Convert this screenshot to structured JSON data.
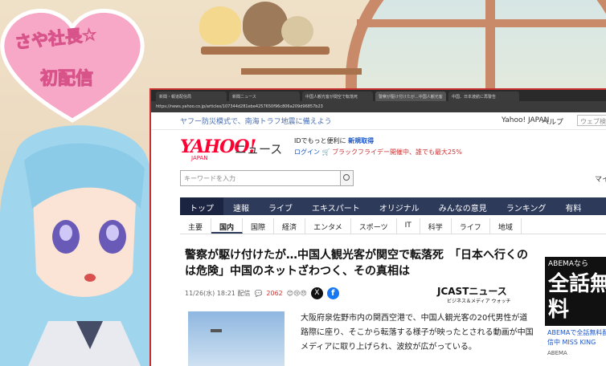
{
  "overlay": {
    "heart_line1": "さや社長☆",
    "heart_line2": "初配信"
  },
  "browser": {
    "tabs": [
      {
        "label": "新聞・報道配信局"
      },
      {
        "label": "新聞ニュース"
      },
      {
        "label": "中国人観光客が関空で転落死"
      },
      {
        "label": "警察が駆け付けたが...中国人観光客"
      },
      {
        "label": "中国、日本渡航に再警告"
      }
    ],
    "url": "https://news.yahoo.co.jp/articles/107344d281ebe4257650f96c806a209d96857b23"
  },
  "yahoo": {
    "disaster_link": "ヤフー防災模式で、南海トラフ地震に備えよう",
    "yahoo_japan_link": "Yahoo! JAPAN",
    "help_link": "ヘルプ",
    "web_search_placeholder": "ウェブ検索",
    "logo_text": "YAHOO!",
    "logo_sub": "JAPAN",
    "logo_news": "ニュース",
    "id_line_text": "IDでもっと便利に",
    "id_line_link": "新規取得",
    "login_label": "ログイン",
    "black_friday": "ブラックフライデー開催中、誰でも最大25%",
    "search_placeholder": "キーワードを入力",
    "mai": "マイ",
    "main_nav": [
      "トップ",
      "速報",
      "ライブ",
      "エキスパート",
      "オリジナル",
      "みんなの意見",
      "ランキング",
      "有料"
    ],
    "sub_nav": [
      "主要",
      "国内",
      "国際",
      "経済",
      "エンタメ",
      "スポーツ",
      "IT",
      "科学",
      "ライフ",
      "地域"
    ]
  },
  "article": {
    "headline": "警察が駆け付けたが…中国人観光客が関空で転落死　「日本へ行くのは危険」中国のネットざわつく、その真相は",
    "datetime": "11/26(水) 18:21 配信",
    "comment_count": "2062",
    "x_label": "X",
    "fb_label": "f",
    "source": "JCASTニュース",
    "source_sub": "ビジネス＆メディア ウォッチ",
    "body": "大阪府泉佐野市内の関西空港で、中国人観光客の20代男性が道路際に座り、そこから転落する様子が映ったとされる動画が中国メディアに取り上げられ、波紋が広がっている。"
  },
  "ad": {
    "header": "ABEMAなら",
    "main": "全話無料",
    "text": "ABEMAで全話無料配信中 MISS KING",
    "brand": "ABEMA"
  },
  "colors": {
    "brand_red": "#ff0033",
    "nav_navy": "#2d3a5a",
    "link_blue": "#1a55c9",
    "heart_pink": "#f6a8c6"
  }
}
